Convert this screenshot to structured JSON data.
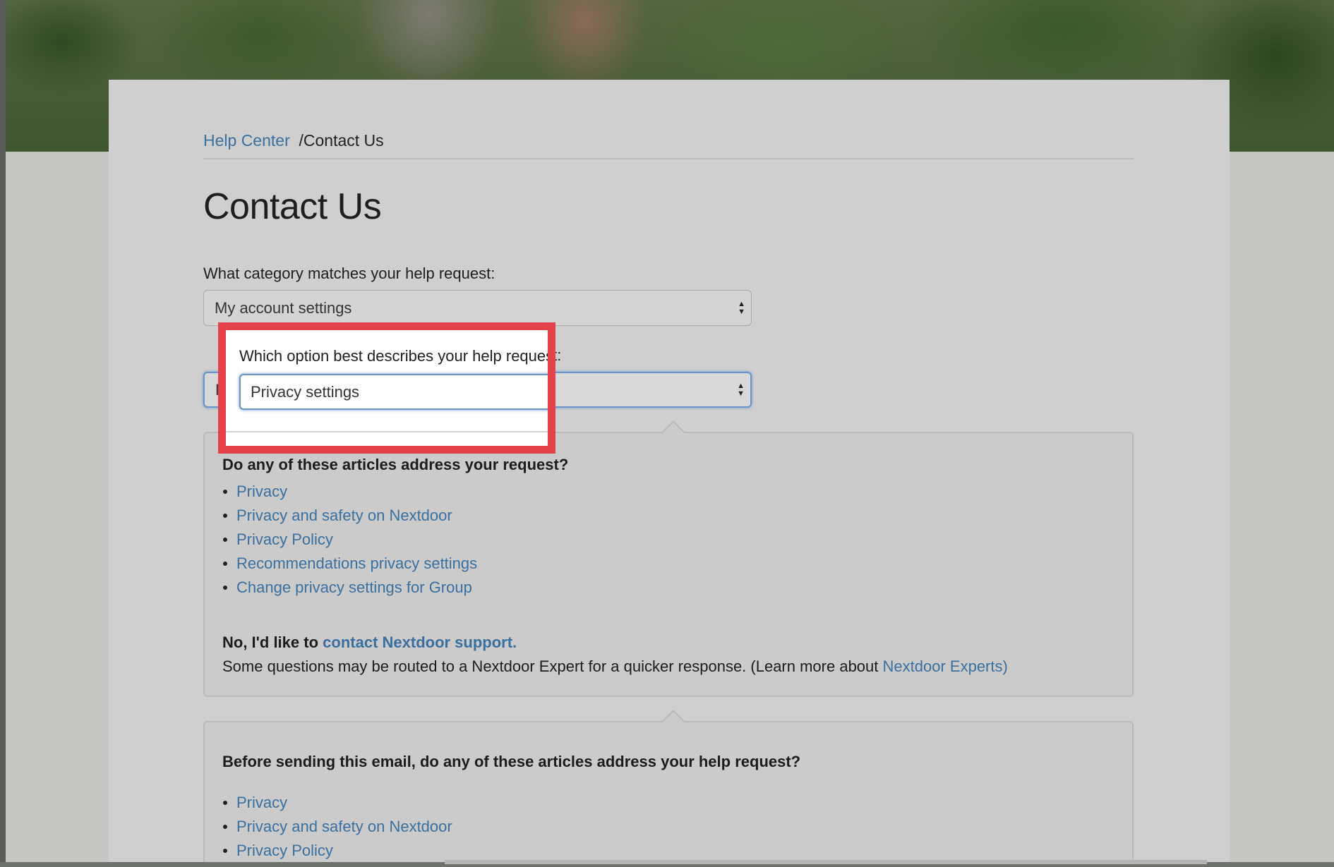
{
  "breadcrumb": {
    "parent": "Help Center",
    "separator": "/",
    "current": "Contact Us"
  },
  "page_title": "Contact Us",
  "category_question": {
    "label": "What category matches your help request:",
    "selected": "My account settings"
  },
  "option_question": {
    "label": "Which option best describes your help request:",
    "selected": "Privacy settings"
  },
  "suggested_articles": {
    "heading": "Do any of these articles address your request?",
    "items": [
      "Privacy",
      "Privacy and safety on Nextdoor",
      "Privacy Policy",
      "Recommendations privacy settings",
      "Change privacy settings for Group"
    ],
    "contact_prefix": "No, I'd like to",
    "contact_link": "contact Nextdoor support.",
    "routed_text": "Some questions may be routed to a Nextdoor Expert for a quicker response. (Learn more about",
    "experts_link": "Nextdoor Experts)"
  },
  "before_sending": {
    "heading": "Before sending this email, do any of these articles address your help request?",
    "items": [
      "Privacy",
      "Privacy and safety on Nextdoor",
      "Privacy Policy"
    ]
  },
  "colors": {
    "link": "#3b6f9e",
    "highlight": "#e5414a",
    "focus_ring": "#6a93c8"
  },
  "icons": {
    "select_arrows": "up-down-caret-icon"
  }
}
